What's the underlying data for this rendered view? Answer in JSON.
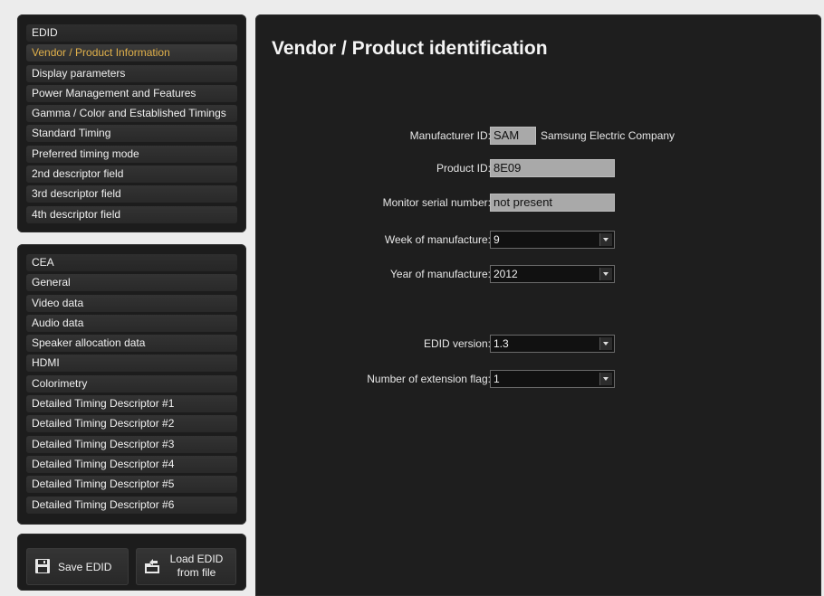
{
  "edid_menu": {
    "items": [
      "EDID",
      "Vendor / Product Information",
      "Display parameters",
      "Power Management and Features",
      "Gamma / Color and Established Timings",
      "Standard Timing",
      "Preferred timing mode",
      "2nd descriptor field",
      "3rd descriptor field",
      "4th descriptor field"
    ],
    "active_index": 1,
    "active_color": "#e0b04a"
  },
  "cea_menu": {
    "items": [
      "CEA",
      "General",
      "Video data",
      "Audio data",
      "Speaker allocation data",
      "HDMI",
      "Colorimetry",
      "Detailed Timing Descriptor #1",
      "Detailed Timing Descriptor #2",
      "Detailed Timing Descriptor #3",
      "Detailed Timing Descriptor #4",
      "Detailed Timing Descriptor #5",
      "Detailed Timing Descriptor #6"
    ]
  },
  "actions": {
    "save_label": "Save EDID",
    "save_icon": "floppy-disk-icon",
    "load_label": "Load EDID\nfrom file",
    "load_icon": "folder-load-icon"
  },
  "main": {
    "title": "Vendor / Product identification",
    "manufacturer_id": {
      "label": "Manufacturer ID:",
      "value": "SAM",
      "name": "Samsung Electric Company"
    },
    "product_id": {
      "label": "Product ID:",
      "value": "8E09"
    },
    "serial_number": {
      "label": "Monitor serial number:",
      "value": "not present"
    },
    "week": {
      "label": "Week of manufacture:",
      "value": "9"
    },
    "year": {
      "label": "Year of manufacture:",
      "value": "2012"
    },
    "edid_version": {
      "label": "EDID version:",
      "value": "1.3"
    },
    "extension_flag": {
      "label": "Number of extension flag:",
      "value": "1"
    }
  }
}
